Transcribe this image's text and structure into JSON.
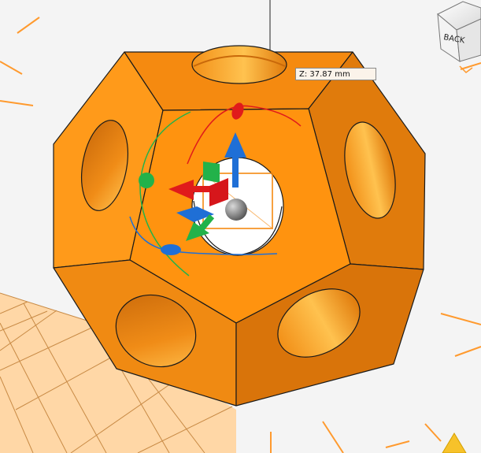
{
  "tooltip": {
    "coordinate_readout": "Z: 37.87 mm"
  },
  "view_cube": {
    "visible_face_label": "BACK"
  },
  "colors": {
    "model_face_light": "#ff9a1a",
    "model_face_mid": "#f58a10",
    "model_face_dark": "#d9740a",
    "hole_inner": "#e07b0c",
    "hole_highlight": "#ffc04d",
    "grid_fill": "#ffd7a6",
    "grid_line": "#c88a45",
    "axis_x_red": "#e01b1b",
    "axis_y_green": "#22b24a",
    "axis_z_blue": "#1f6fd6",
    "background": "#f4f4f4",
    "tick_orange": "#ff9a2e"
  },
  "gizmo": {
    "translate_axes": [
      "x-arrow",
      "y-arrow",
      "z-arrow"
    ],
    "rotate_rings": [
      "x-ring",
      "y-ring",
      "z-ring"
    ],
    "plane_handles": [
      "xy-plane",
      "xz-plane",
      "yz-plane"
    ],
    "center_handle": "free-move-sphere"
  }
}
